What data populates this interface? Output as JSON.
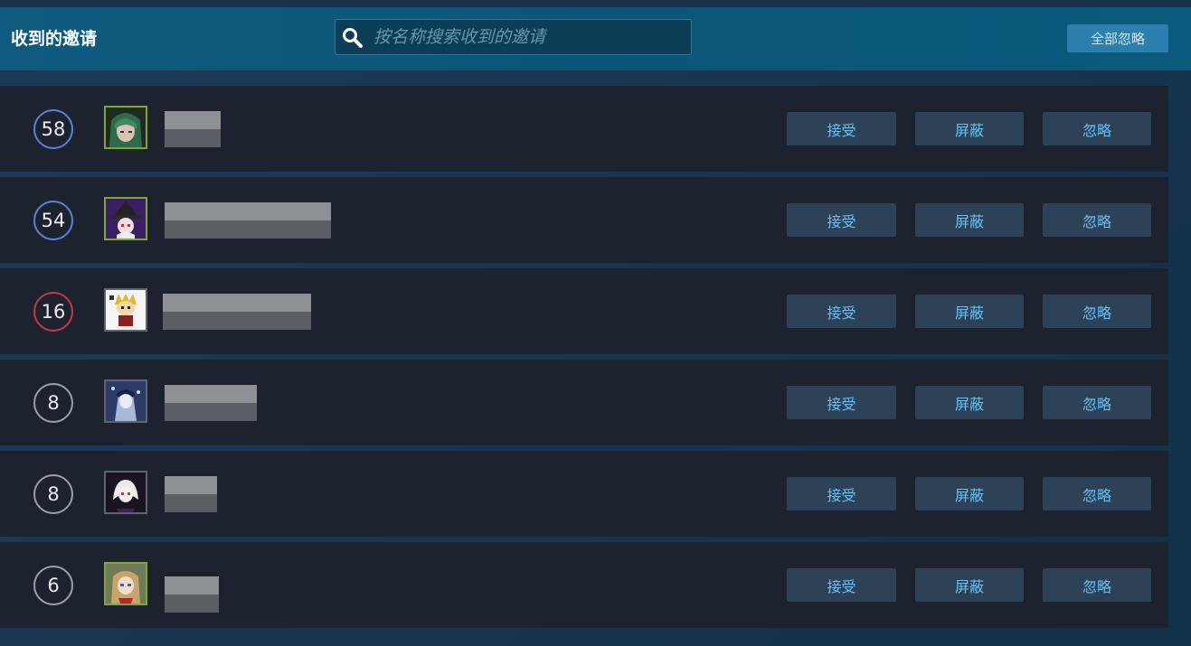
{
  "header": {
    "title": "收到的邀请",
    "search_placeholder": "按名称搜索收到的邀请",
    "search_value": "",
    "ignore_all_label": "全部忽略"
  },
  "colors": {
    "header_bg": "#0b5677",
    "row_bg": "#1c232e",
    "button_bg": "#2e4257",
    "button_text": "#67c1f5",
    "ignore_all_bg": "#2a7fad",
    "level_blue": "#5b82d6",
    "level_red": "#c23a46",
    "level_grey": "#9aa0a6",
    "online_border": "#7ea43a"
  },
  "invites": [
    {
      "level": "58",
      "level_color": "blue",
      "avatar": "green-hair-avatar",
      "avatar_online": true,
      "buttons": {
        "accept": "接受",
        "block": "屏蔽",
        "ignore": "忽略"
      }
    },
    {
      "level": "54",
      "level_color": "blue",
      "avatar": "witch-hat-avatar",
      "avatar_online": true,
      "buttons": {
        "accept": "接受",
        "block": "屏蔽",
        "ignore": "忽略"
      }
    },
    {
      "level": "16",
      "level_color": "red",
      "avatar": "chibi-character-avatar",
      "avatar_online": false,
      "buttons": {
        "accept": "接受",
        "block": "屏蔽",
        "ignore": "忽略"
      }
    },
    {
      "level": "8",
      "level_color": "grey",
      "avatar": "snow-character-avatar",
      "avatar_online": false,
      "buttons": {
        "accept": "接受",
        "block": "屏蔽",
        "ignore": "忽略"
      }
    },
    {
      "level": "8",
      "level_color": "grey",
      "avatar": "white-hair-avatar",
      "avatar_online": false,
      "buttons": {
        "accept": "接受",
        "block": "屏蔽",
        "ignore": "忽略"
      }
    },
    {
      "level": "6",
      "level_color": "grey",
      "avatar": "anime-girl-avatar",
      "avatar_online": true,
      "buttons": {
        "accept": "接受",
        "block": "屏蔽",
        "ignore": "忽略"
      }
    }
  ]
}
